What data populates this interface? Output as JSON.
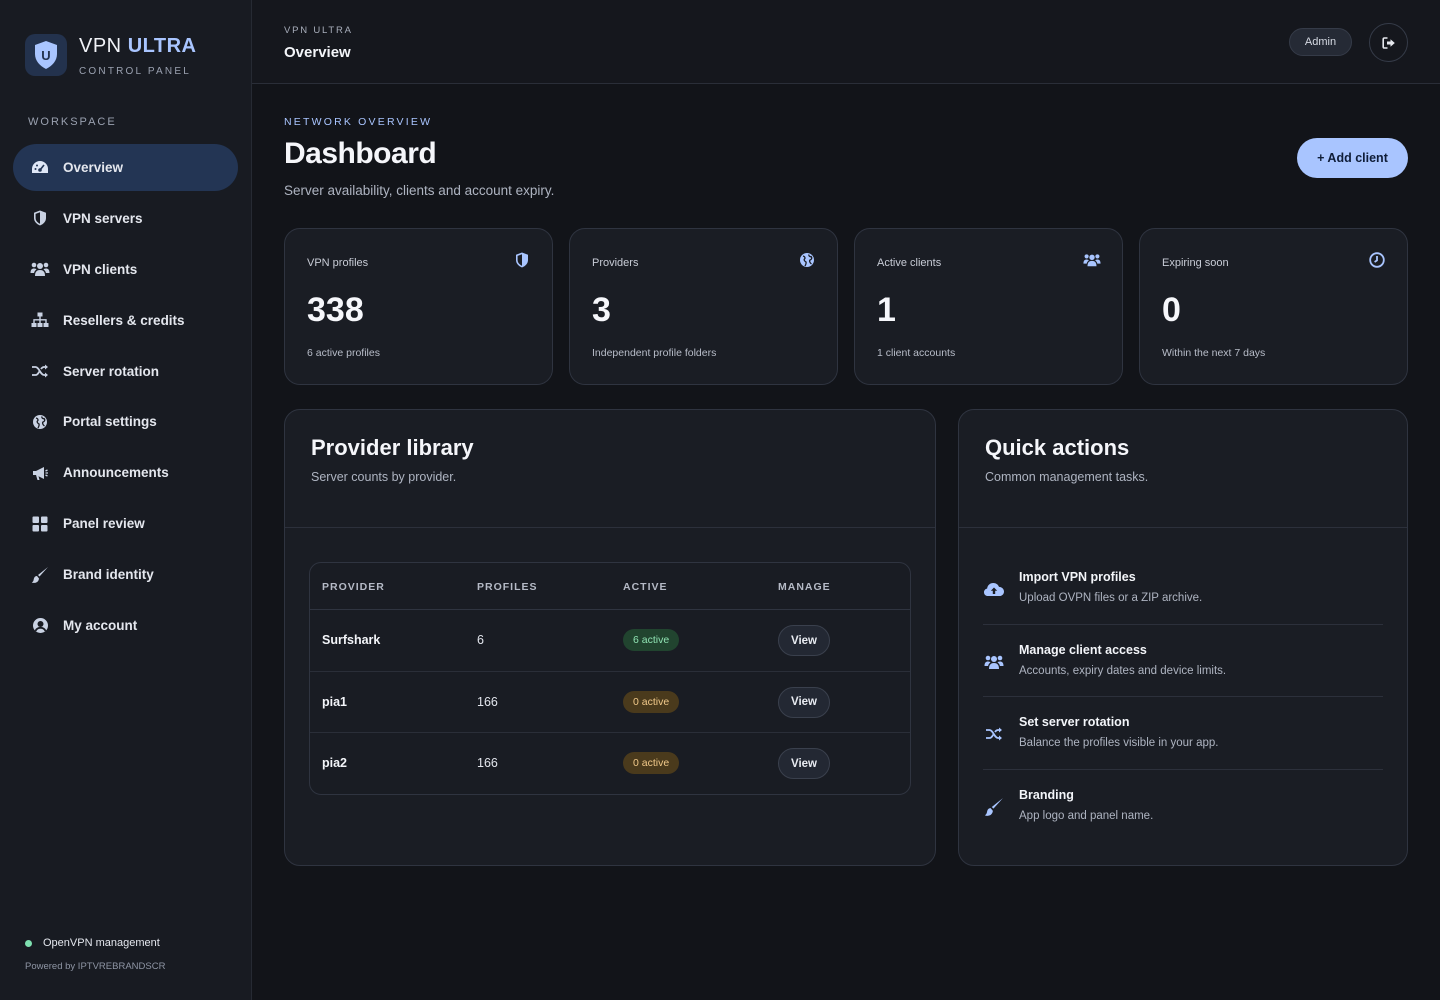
{
  "brand": {
    "name": "VPN",
    "name_accent": "ULTRA",
    "subtitle": "CONTROL PANEL",
    "logo_letter": "U"
  },
  "sidebar": {
    "section_label": "WORKSPACE",
    "items": [
      {
        "label": "Overview",
        "icon": "dashboard-gauge-icon",
        "active": true
      },
      {
        "label": "VPN servers",
        "icon": "shield-icon"
      },
      {
        "label": "VPN clients",
        "icon": "users-icon"
      },
      {
        "label": "Resellers & credits",
        "icon": "sitemap-icon"
      },
      {
        "label": "Server rotation",
        "icon": "shuffle-icon"
      },
      {
        "label": "Portal settings",
        "icon": "globe-icon"
      },
      {
        "label": "Announcements",
        "icon": "megaphone-icon"
      },
      {
        "label": "Panel review",
        "icon": "grid-icon"
      },
      {
        "label": "Brand identity",
        "icon": "paintbrush-icon"
      },
      {
        "label": "My account",
        "icon": "user-circle-icon"
      }
    ],
    "footer": {
      "status": "OpenVPN management",
      "powered": "Powered by IPTVREBRANDSCR"
    }
  },
  "header": {
    "breadcrumb": "VPN ULTRA",
    "title": "Overview",
    "user_badge": "Admin"
  },
  "main": {
    "eyebrow": "NETWORK OVERVIEW",
    "title": "Dashboard",
    "subtitle": "Server availability, clients and account expiry.",
    "add_button": "+ Add client"
  },
  "stats": [
    {
      "label": "VPN profiles",
      "value": "338",
      "note": "6 active profiles",
      "icon": "shield-icon"
    },
    {
      "label": "Providers",
      "value": "3",
      "note": "Independent profile folders",
      "icon": "globe-icon"
    },
    {
      "label": "Active clients",
      "value": "1",
      "note": "1 client accounts",
      "icon": "users-icon"
    },
    {
      "label": "Expiring soon",
      "value": "0",
      "note": "Within the next 7 days",
      "icon": "clock-icon"
    }
  ],
  "provider_library": {
    "title": "Provider library",
    "subtitle": "Server counts by provider.",
    "columns": [
      "PROVIDER",
      "PROFILES",
      "ACTIVE",
      "MANAGE"
    ],
    "rows": [
      {
        "provider": "Surfshark",
        "profiles": "6",
        "active": "6 active",
        "status": "green",
        "action": "View"
      },
      {
        "provider": "pia1",
        "profiles": "166",
        "active": "0 active",
        "status": "amber",
        "action": "View"
      },
      {
        "provider": "pia2",
        "profiles": "166",
        "active": "0 active",
        "status": "amber",
        "action": "View"
      }
    ]
  },
  "quick_actions": {
    "title": "Quick actions",
    "subtitle": "Common management tasks.",
    "items": [
      {
        "title": "Import VPN profiles",
        "desc": "Upload OVPN files or a ZIP archive.",
        "icon": "cloud-upload-icon"
      },
      {
        "title": "Manage client access",
        "desc": "Accounts, expiry dates and device limits.",
        "icon": "users-icon"
      },
      {
        "title": "Set server rotation",
        "desc": "Balance the profiles visible in your app.",
        "icon": "shuffle-icon"
      },
      {
        "title": "Branding",
        "desc": "App logo and panel name.",
        "icon": "paintbrush-icon"
      }
    ]
  },
  "colors": {
    "accent": "#a9c5ff",
    "active_nav": "#233554",
    "success": "#8fe2b2",
    "warning": "#f1c98a",
    "background": "#121419"
  }
}
